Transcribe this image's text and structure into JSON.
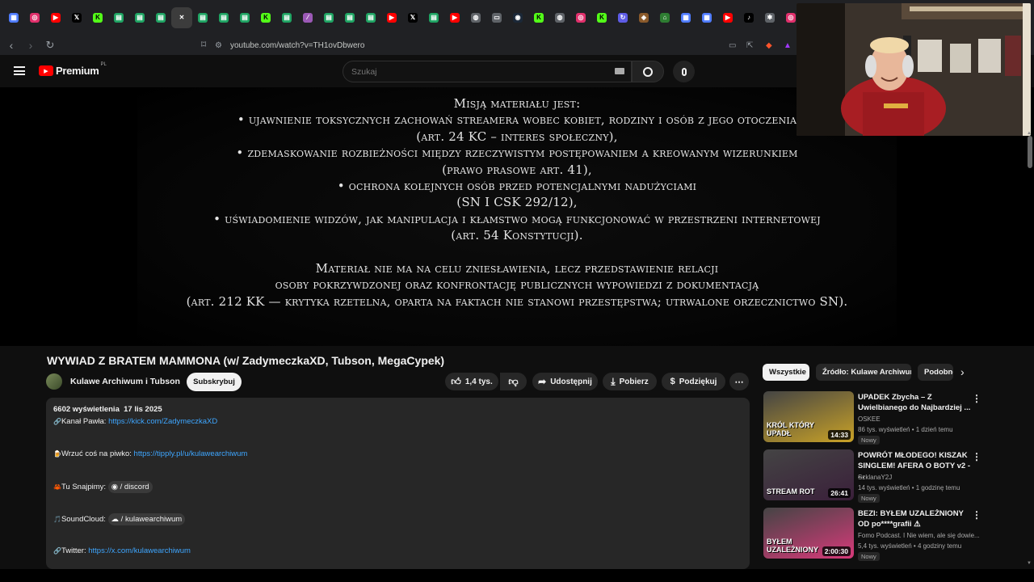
{
  "browser": {
    "url": "youtube.com/watch?v=TH1ovDbwero",
    "tabs": [
      {
        "icon": "grid-icon",
        "color": "#4f7cff",
        "glyph": "▦"
      },
      {
        "icon": "instagram-icon",
        "color": "#e1306c",
        "glyph": "◎"
      },
      {
        "icon": "youtube-icon",
        "color": "#ff0000",
        "glyph": "▶"
      },
      {
        "icon": "x-icon",
        "color": "#000000",
        "glyph": "𝕏"
      },
      {
        "icon": "kick-icon",
        "color": "#53fc18",
        "glyph": "K"
      },
      {
        "icon": "sheet-icon",
        "color": "#1fa463",
        "glyph": "▤"
      },
      {
        "icon": "sheet-icon",
        "color": "#1fa463",
        "glyph": "▤"
      },
      {
        "icon": "sheet-icon",
        "color": "#1fa463",
        "glyph": "▤"
      },
      {
        "icon": "close-icon",
        "color": "#3c3c3c",
        "glyph": "✕"
      },
      {
        "icon": "sheet-icon",
        "color": "#1fa463",
        "glyph": "▤"
      },
      {
        "icon": "sheet-icon",
        "color": "#1fa463",
        "glyph": "▤"
      },
      {
        "icon": "sheet-icon",
        "color": "#1fa463",
        "glyph": "▤"
      },
      {
        "icon": "kick-icon",
        "color": "#53fc18",
        "glyph": "K"
      },
      {
        "icon": "sheet-icon",
        "color": "#1fa463",
        "glyph": "▤"
      },
      {
        "icon": "feather-icon",
        "color": "#9b59b6",
        "glyph": "⁄"
      },
      {
        "icon": "sheet-icon",
        "color": "#1fa463",
        "glyph": "▤"
      },
      {
        "icon": "sheet-icon",
        "color": "#1fa463",
        "glyph": "▤"
      },
      {
        "icon": "sheet-icon",
        "color": "#1fa463",
        "glyph": "▤"
      },
      {
        "icon": "youtube-icon",
        "color": "#ff0000",
        "glyph": "▶"
      },
      {
        "icon": "x-icon",
        "color": "#000000",
        "glyph": "𝕏"
      },
      {
        "icon": "sheet-icon",
        "color": "#1fa463",
        "glyph": "▤"
      },
      {
        "icon": "youtube-icon",
        "color": "#ff0000",
        "glyph": "▶"
      },
      {
        "icon": "globe-icon",
        "color": "#5f6368",
        "glyph": "◍"
      },
      {
        "icon": "doc-icon",
        "color": "#5f6368",
        "glyph": "▭"
      },
      {
        "icon": "steam-icon",
        "color": "#1b2838",
        "glyph": "◉"
      },
      {
        "icon": "kick-icon",
        "color": "#53fc18",
        "glyph": "K"
      },
      {
        "icon": "globe-icon",
        "color": "#5f6368",
        "glyph": "◍"
      },
      {
        "icon": "instagram-icon",
        "color": "#e1306c",
        "glyph": "◎"
      },
      {
        "icon": "kick-icon",
        "color": "#53fc18",
        "glyph": "K"
      },
      {
        "icon": "sync-icon",
        "color": "#5e5ce6",
        "glyph": "↻"
      },
      {
        "icon": "shield-icon",
        "color": "#8a5a2b",
        "glyph": "◈"
      },
      {
        "icon": "bank-icon",
        "color": "#2e7d32",
        "glyph": "⌂"
      },
      {
        "icon": "grid-icon",
        "color": "#4f7cff",
        "glyph": "▦"
      },
      {
        "icon": "grid-icon",
        "color": "#4f7cff",
        "glyph": "▦"
      },
      {
        "icon": "youtube-icon",
        "color": "#ff0000",
        "glyph": "▶"
      },
      {
        "icon": "tiktok-icon",
        "color": "#000000",
        "glyph": "♪"
      },
      {
        "icon": "puzzle-icon",
        "color": "#5f6368",
        "glyph": "✱"
      },
      {
        "icon": "instagram-icon",
        "color": "#e1306c",
        "glyph": "◎"
      }
    ]
  },
  "youtube": {
    "logo_text": "Premium",
    "logo_region": "PL",
    "search_placeholder": "Szukaj"
  },
  "video_overlay": {
    "lines": [
      "Misją materiału jest:",
      "• ujawnienie toksycznych zachowań streamera wobec kobiet, rodziny i osób z jego otoczenia",
      "(art. 24 KC – interes społeczny),",
      "• zdemaskowanie rozbieżności między rzeczywistym postępowaniem a kreowanym wizerunkiem",
      "(prawo prasowe art. 41),",
      "• ochrona kolejnych osób przed potencjalnymi nadużyciami",
      "(SN I CSK 292/12),",
      "• uświadomienie widzów, jak manipulacja i kłamstwo mogą funkcjonować w przestrzeni internetowej",
      "(art. 54 Konstytucji).",
      "",
      "Materiał nie ma na celu zniesławienia, lecz przedstawienie relacji",
      "osoby pokrzywdzonej oraz konfrontację publicznych wypowiedzi z dokumentacją",
      "(art. 212 KK — krytyka rzetelna, oparta na faktach nie stanowi przestępstwa; utrwalone orzecznictwo SN)."
    ]
  },
  "video_meta": {
    "title": "WYWIAD Z BRATEM MAMMONA (w/ ZadymeczkaXD, Tubson, MegaCypek)",
    "channel": "Kulawe Archiwum i Tubson",
    "subscribe": "Subskrybuj",
    "likes": "1,4 tys.",
    "share": "Udostępnij",
    "download": "Pobierz",
    "thanks": "Podziękuj"
  },
  "description": {
    "stats": "6602 wyświetlenia  17 lis 2025",
    "lines": [
      {
        "emoji": "🔗",
        "label": "Kanał Pawła: ",
        "link": "https://kick.com/ZadymeczkaXD",
        "chip": ""
      },
      {
        "emoji": "🍺",
        "label": "Wrzuć coś na piwko: ",
        "link": "https://tipply.pl/u/kulawearchiwum",
        "chip": ""
      },
      {
        "emoji": "🦀",
        "label": "Tu Snajpimy: ",
        "link": "",
        "chip": "◉ / discord"
      },
      {
        "emoji": "🎵",
        "label": "SoundCloud: ",
        "link": "",
        "chip": "☁ / kulawearchiwum"
      },
      {
        "emoji": "🔗",
        "label": "Twitter: ",
        "link": "https://x.com/kulawearchiwum",
        "chip": ""
      }
    ]
  },
  "sidebar": {
    "chips": [
      "Wszystkie",
      "Źródło: Kulawe Archiwum",
      "Podobne"
    ],
    "videos": [
      {
        "title": "UPADEK Zbycha – Z Uwielbianego do Najbardziej ...",
        "channel": "OSKEE",
        "meta": "86 tys. wyświetleń • 1 dzień temu",
        "badge": "Nowy",
        "duration": "14:33",
        "thumb_text": "KRÓL KTÓRY UPADŁ",
        "thumb_color": "#c9a227"
      },
      {
        "title": "POWRÓT MŁODEGO! KISZAK SINGLEM! AFERA O BOTY v2 - ...",
        "channel": "SzklanaY2J",
        "meta": "14 tys. wyświetleń • 1 godzinę temu",
        "badge": "Nowy",
        "duration": "26:41",
        "thumb_text": "STREAM ROT",
        "thumb_color": "#3a1f3a"
      },
      {
        "title": "BEZI: BYŁEM UZALEŻNIONY OD po****grafii ⚠",
        "channel": "Fomo Podcast. I Nie wiem, ale się dowie...",
        "meta": "5,4 tys. wyświetleń • 4 godziny temu",
        "badge": "Nowy",
        "duration": "2:00:30",
        "thumb_text": "BYŁEM UZALEŻNIONY",
        "thumb_color": "#d83a7a"
      }
    ]
  }
}
